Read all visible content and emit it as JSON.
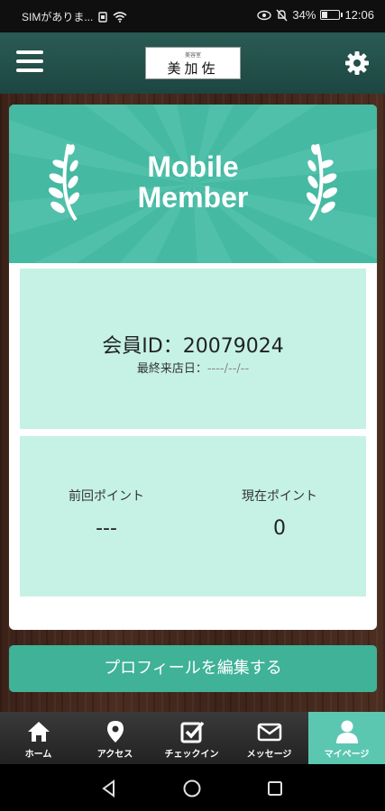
{
  "status_bar": {
    "carrier": "SIMがありま...",
    "battery_percent": "34%",
    "battery_level": 0.34,
    "time": "12:06"
  },
  "header": {
    "logo_small": "美容室",
    "logo_big": "美加佐"
  },
  "banner": {
    "title_line1": "Mobile",
    "title_line2": "Member"
  },
  "member": {
    "id_label": "会員ID：20079024",
    "last_visit_label": "最終来店日：",
    "last_visit_value": "----/--/--"
  },
  "points": {
    "previous_label": "前回ポイント",
    "previous_value": "---",
    "current_label": "現在ポイント",
    "current_value": "0"
  },
  "edit_profile_label": "プロフィールを編集する",
  "tabs": [
    {
      "label": "ホーム",
      "icon": "home-icon",
      "active": false
    },
    {
      "label": "アクセス",
      "icon": "map-pin-icon",
      "active": false
    },
    {
      "label": "チェックイン",
      "icon": "checkin-icon",
      "active": false
    },
    {
      "label": "メッセージ",
      "icon": "mail-icon",
      "active": false
    },
    {
      "label": "マイページ",
      "icon": "person-icon",
      "active": true
    }
  ],
  "colors": {
    "accent": "#45b9a2",
    "panel": "#c6f2e6",
    "button": "#3fb298",
    "header": "#2a5b55"
  }
}
